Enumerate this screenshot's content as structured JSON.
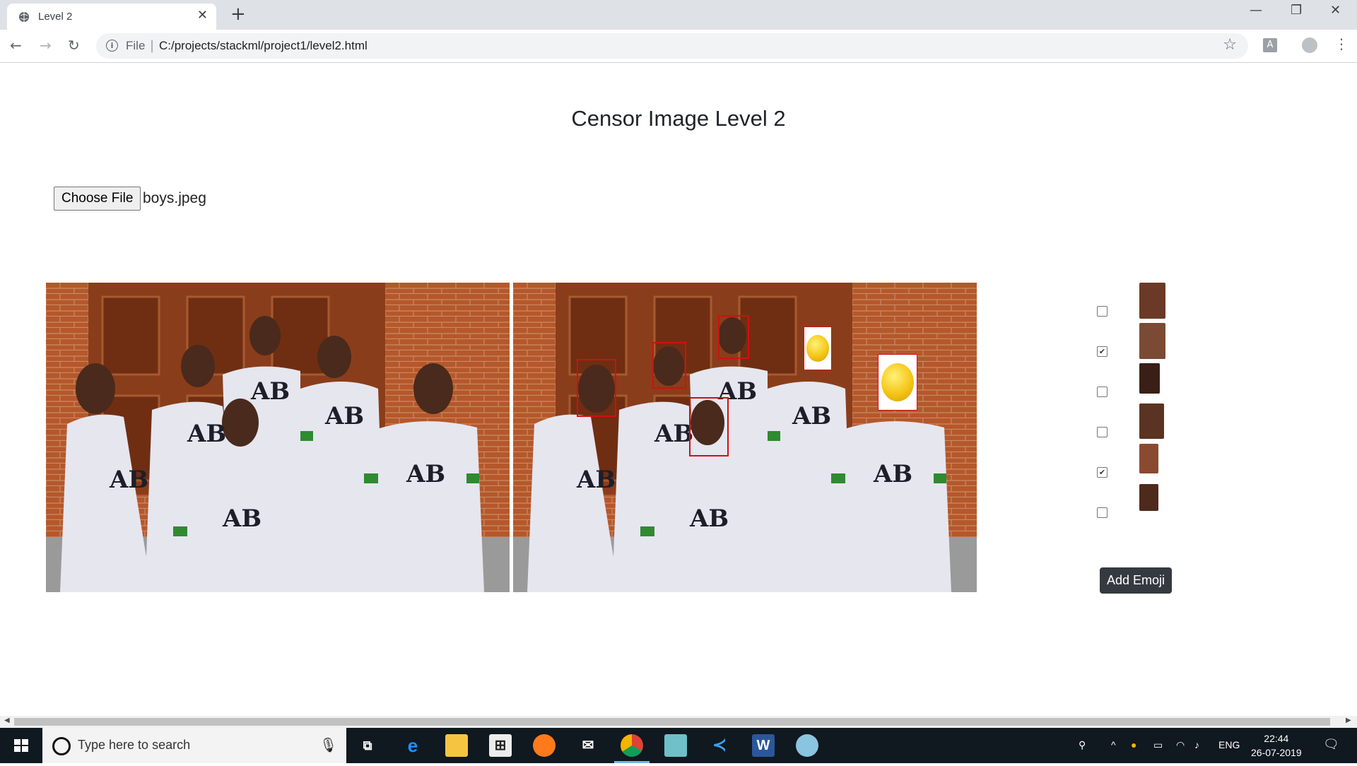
{
  "browser": {
    "tab_title": "Level 2",
    "url_scheme": "File",
    "url": "C:/projects/stackml/project1/level2.html"
  },
  "page": {
    "title": "Censor Image Level 2",
    "choose_file_label": "Choose File",
    "file_name": "boys.jpeg",
    "add_emoji_label": "Add Emoji"
  },
  "faces": [
    {
      "checked": false,
      "skin": "#6b3a26"
    },
    {
      "checked": true,
      "skin": "#7a4a34"
    },
    {
      "checked": false,
      "skin": "#3a1f16"
    },
    {
      "checked": false,
      "skin": "#5a3322"
    },
    {
      "checked": true,
      "skin": "#8a4a30"
    },
    {
      "checked": false,
      "skin": "#4e2a1c"
    }
  ],
  "taskbar": {
    "search_placeholder": "Type here to search",
    "language": "ENG",
    "time": "22:44",
    "date": "26-07-2019"
  }
}
